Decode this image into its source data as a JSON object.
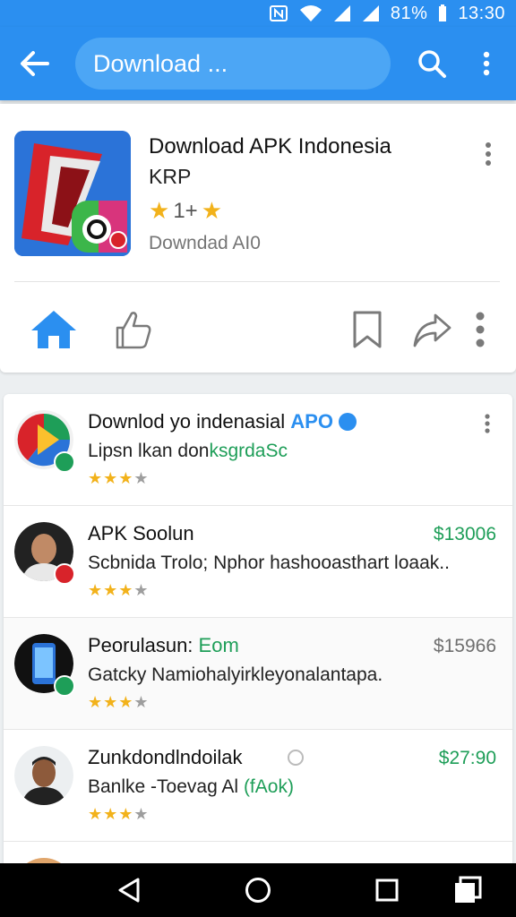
{
  "status_bar": {
    "icons": [
      "nfc-icon",
      "wifi-icon",
      "signal-icon",
      "signal-icon"
    ],
    "battery": "81%",
    "time": "13:30"
  },
  "app_bar": {
    "search_text": "Download ...",
    "icons": {
      "back": "arrow-left-icon",
      "search": "search-icon",
      "more": "more-vertical-icon"
    }
  },
  "app_card": {
    "title": "Download APK Indonesia",
    "subtitle": "KRP",
    "rating": "1+",
    "meta": "Downdad AI0",
    "actions": [
      "home-icon",
      "thumb-up-icon",
      "bookmark-icon",
      "share-icon",
      "more-vertical-icon"
    ]
  },
  "list": {
    "items": [
      {
        "title": "Downlod yo indenasial",
        "title_suffix": "APO",
        "desc_prefix": "Lipsn lkan don",
        "desc_suffix": "ksgrdaSc",
        "price": "",
        "rating": 3
      },
      {
        "title": "APK Soolun",
        "desc": "Scbnida Trolo; Nphor hashooasthart loaak..",
        "price": "$13006",
        "rating": 3
      },
      {
        "title": "Peorulasun:",
        "title_suffix": "Eom",
        "desc": "Gatcky Namiohalyirkleyonalantapa.",
        "price": "$15966",
        "rating": 3
      },
      {
        "title": "Zunkdondlndoilak",
        "desc_prefix": "Banlke -Toevag Al ",
        "desc_suffix": "(fAok)",
        "price": "$27:90",
        "rating": 3
      }
    ]
  },
  "colors": {
    "primary": "#2b8ff0",
    "star": "#f2b21b",
    "price_green": "#1e9e58"
  }
}
